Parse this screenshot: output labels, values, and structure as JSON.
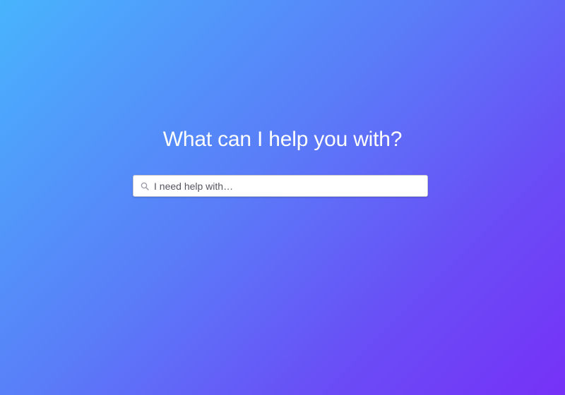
{
  "hero": {
    "headline": "What can I help you with?"
  },
  "search": {
    "icon": "search-icon",
    "placeholder": "I need help with…",
    "value": ""
  },
  "colors": {
    "gradient_start": "#48b4fd",
    "gradient_end": "#7631f7",
    "text": "#ffffff"
  }
}
